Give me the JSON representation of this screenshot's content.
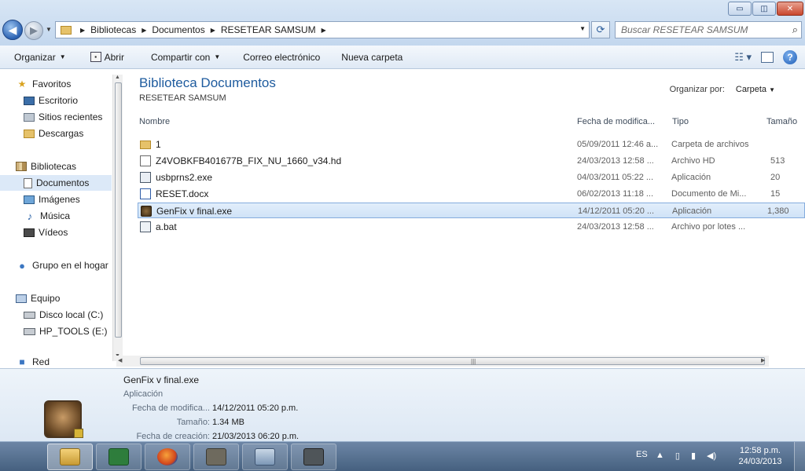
{
  "window_buttons": {
    "minimize": "▭",
    "maximize": "◫",
    "close": "✕"
  },
  "address": {
    "crumbs": [
      "Bibliotecas",
      "Documentos",
      "RESETEAR SAMSUM"
    ],
    "search_placeholder": "Buscar RESETEAR SAMSUM"
  },
  "toolbar": {
    "organize": "Organizar",
    "open": "Abrir",
    "share": "Compartir con",
    "email": "Correo electrónico",
    "new_folder": "Nueva carpeta"
  },
  "sidebar": {
    "favorites": "Favoritos",
    "desktop": "Escritorio",
    "recent": "Sitios recientes",
    "downloads": "Descargas",
    "libraries": "Bibliotecas",
    "documents": "Documentos",
    "images": "Imágenes",
    "music": "Música",
    "videos": "Vídeos",
    "homegroup": "Grupo en el hogar",
    "computer": "Equipo",
    "local_disk": "Disco local (C:)",
    "hp_tools": "HP_TOOLS (E:)",
    "network": "Red"
  },
  "main": {
    "title": "Biblioteca Documentos",
    "subtitle": "RESETEAR SAMSUM",
    "arrange_label": "Organizar por:",
    "arrange_value": "Carpeta",
    "columns": {
      "name": "Nombre",
      "date": "Fecha de modifica...",
      "type": "Tipo",
      "size": "Tamaño"
    },
    "files": [
      {
        "name": "1",
        "date": "05/09/2011 12:46 a...",
        "type": "Carpeta de archivos",
        "size": "",
        "icon": "folder"
      },
      {
        "name": "Z4VOBKFB401677B_FIX_NU_1660_v34.hd",
        "date": "24/03/2013 12:58 ...",
        "type": "Archivo HD",
        "size": "513",
        "icon": "file"
      },
      {
        "name": "usbprns2.exe",
        "date": "04/03/2011 05:22 ...",
        "type": "Aplicación",
        "size": "20",
        "icon": "exe"
      },
      {
        "name": "RESET.docx",
        "date": "06/02/2013 11:18 ...",
        "type": "Documento de Mi...",
        "size": "15",
        "icon": "word"
      },
      {
        "name": "GenFix v final.exe",
        "date": "14/12/2011 05:20 ...",
        "type": "Aplicación",
        "size": "1,380",
        "icon": "genfix"
      },
      {
        "name": "a.bat",
        "date": "24/03/2013 12:58 ...",
        "type": "Archivo por lotes ...",
        "size": "",
        "icon": "bat"
      }
    ]
  },
  "details": {
    "name": "GenFix v final.exe",
    "kind": "Aplicación",
    "modified_label": "Fecha de modifica...",
    "modified_value": "14/12/2011 05:20 p.m.",
    "size_label": "Tamaño:",
    "size_value": "1.34 MB",
    "created_label": "Fecha de creación:",
    "created_value": "21/03/2013 06:20 p.m."
  },
  "taskbar": {
    "lang": "ES",
    "time": "12:58 p.m.",
    "date": "24/03/2013"
  }
}
